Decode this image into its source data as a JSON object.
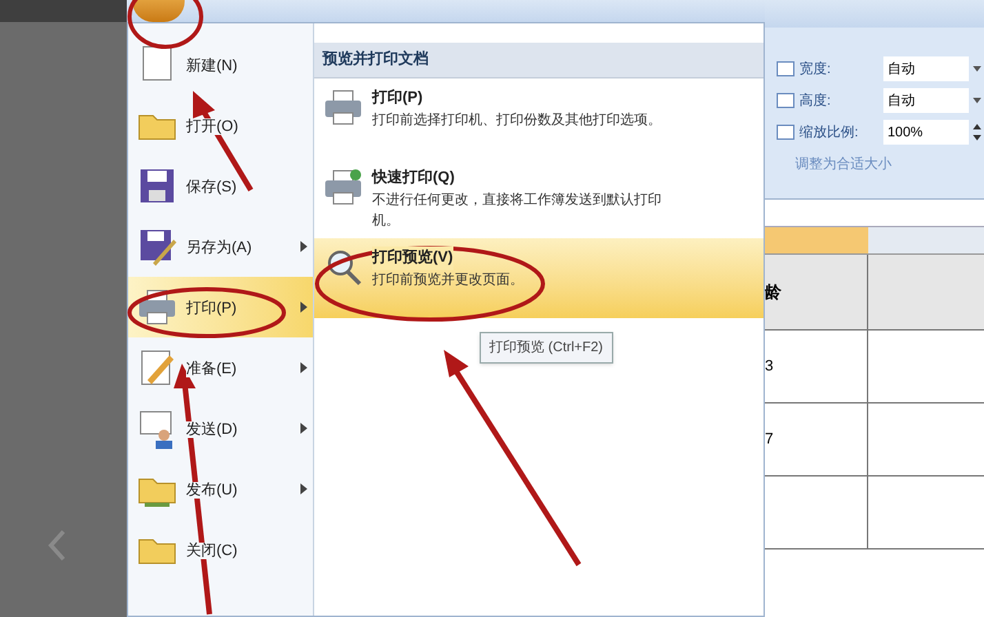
{
  "office_menu": {
    "items": [
      {
        "label": "新建(N)",
        "submenu": false,
        "selected": false
      },
      {
        "label": "打开(O)",
        "submenu": false,
        "selected": false
      },
      {
        "label": "保存(S)",
        "submenu": false,
        "selected": false
      },
      {
        "label": "另存为(A)",
        "submenu": true,
        "selected": false
      },
      {
        "label": "打印(P)",
        "submenu": true,
        "selected": true
      },
      {
        "label": "准备(E)",
        "submenu": true,
        "selected": false
      },
      {
        "label": "发送(D)",
        "submenu": true,
        "selected": false
      },
      {
        "label": "发布(U)",
        "submenu": true,
        "selected": false
      },
      {
        "label": "关闭(C)",
        "submenu": false,
        "selected": false
      }
    ]
  },
  "submenu": {
    "title": "预览并打印文档",
    "items": [
      {
        "title": "打印(P)",
        "description": "打印前选择打印机、打印份数及其他打印选项。",
        "selected": false
      },
      {
        "title": "快速打印(Q)",
        "description": "不进行任何更改，直接将工作簿发送到默认打印机。",
        "selected": false
      },
      {
        "title": "打印预览(V)",
        "description": "打印前预览并更改页面。",
        "selected": true
      }
    ]
  },
  "tooltip": "打印预览 (Ctrl+F2)",
  "page_setup": {
    "fields": [
      {
        "label": "宽度:",
        "value": "自动",
        "kind": "dropdown"
      },
      {
        "label": "高度:",
        "value": "自动",
        "kind": "dropdown"
      },
      {
        "label": "缩放比例:",
        "value": "100%",
        "kind": "spinner"
      }
    ],
    "group_label": "调整为合适大小"
  },
  "sheet": {
    "header": "龄",
    "cells": [
      "3",
      "7"
    ]
  }
}
